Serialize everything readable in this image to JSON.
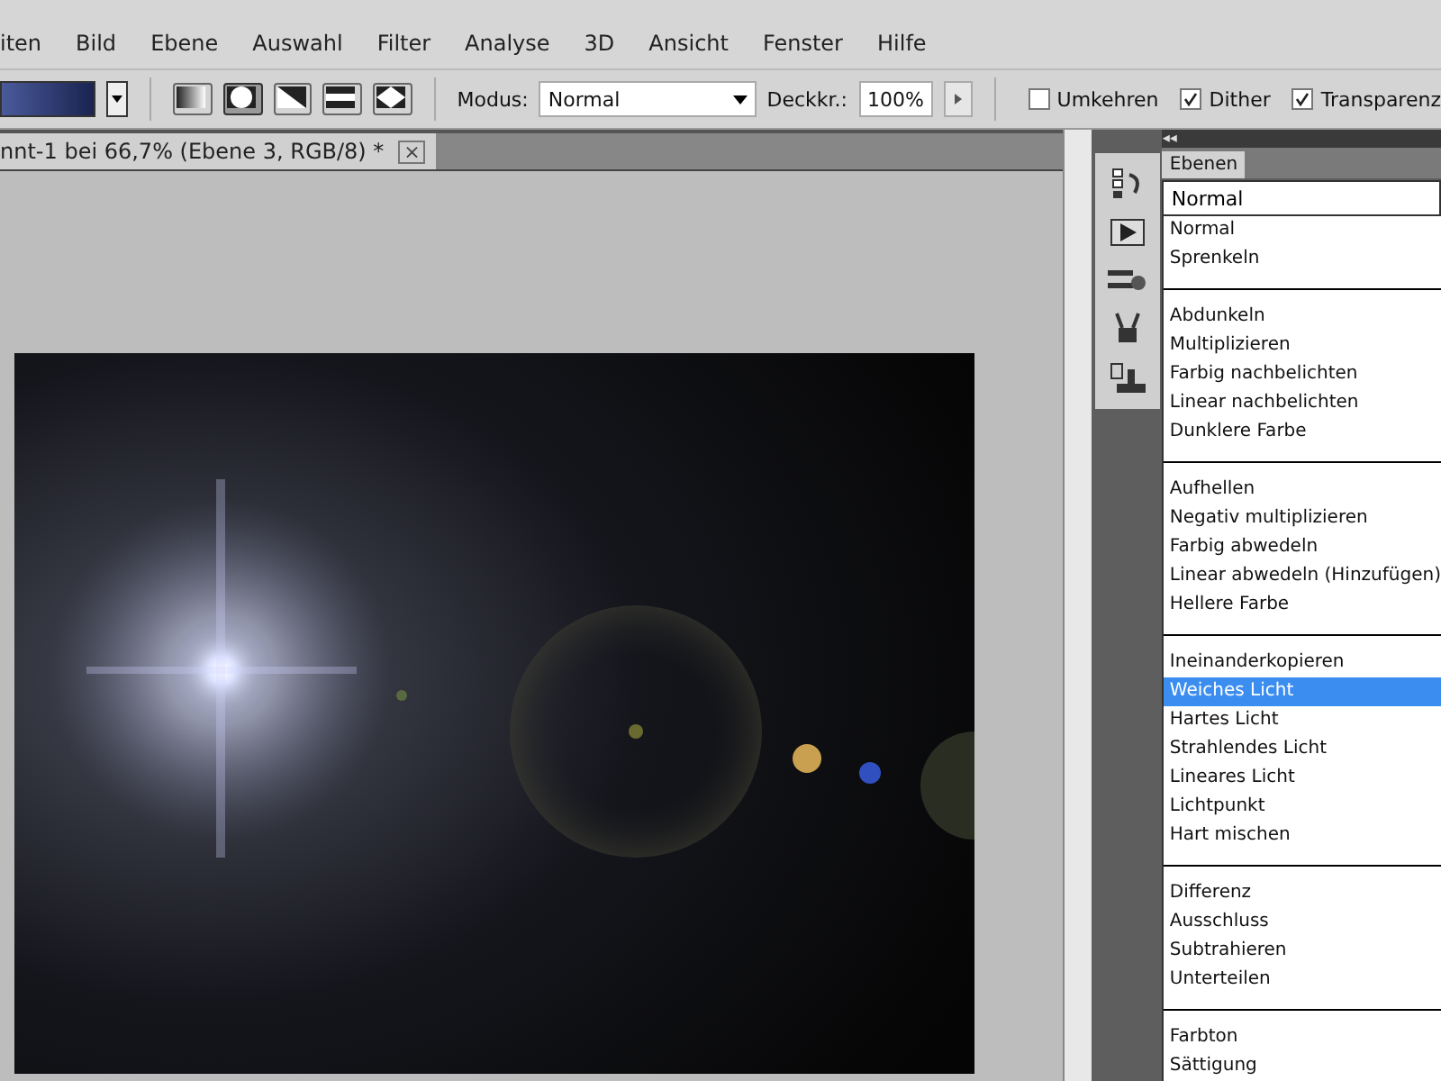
{
  "menu": [
    "iten",
    "Bild",
    "Ebene",
    "Auswahl",
    "Filter",
    "Analyse",
    "3D",
    "Ansicht",
    "Fenster",
    "Hilfe"
  ],
  "options": {
    "gradient_types": [
      {
        "selected": false
      },
      {
        "selected": true
      },
      {
        "selected": false
      },
      {
        "selected": false
      },
      {
        "selected": false
      }
    ],
    "mode_label": "Modus:",
    "mode_value": "Normal",
    "opacity_label": "Deckkr.:",
    "opacity_value": "100%",
    "checkboxes": [
      {
        "label": "Umkehren",
        "checked": false
      },
      {
        "label": "Dither",
        "checked": true
      },
      {
        "label": "Transparenz",
        "checked": true
      }
    ]
  },
  "document_tab": {
    "title": "nnt-1 bei 66,7% (Ebene 3, RGB/8) *",
    "close": "×"
  },
  "panel": {
    "collapse": "◂◂",
    "tab": "Ebenen",
    "blend_field": "Normal",
    "groups": [
      [
        {
          "label": "Normal",
          "selected": false
        },
        {
          "label": "Sprenkeln",
          "selected": false
        }
      ],
      [
        {
          "label": "Abdunkeln",
          "selected": false
        },
        {
          "label": "Multiplizieren",
          "selected": false
        },
        {
          "label": "Farbig nachbelichten",
          "selected": false
        },
        {
          "label": "Linear nachbelichten",
          "selected": false
        },
        {
          "label": "Dunklere Farbe",
          "selected": false
        }
      ],
      [
        {
          "label": "Aufhellen",
          "selected": false
        },
        {
          "label": "Negativ multiplizieren",
          "selected": false
        },
        {
          "label": "Farbig abwedeln",
          "selected": false
        },
        {
          "label": "Linear abwedeln (Hinzufügen)",
          "selected": false
        },
        {
          "label": "Hellere Farbe",
          "selected": false
        }
      ],
      [
        {
          "label": "Ineinanderkopieren",
          "selected": false
        },
        {
          "label": "Weiches Licht",
          "selected": true
        },
        {
          "label": "Hartes Licht",
          "selected": false
        },
        {
          "label": "Strahlendes Licht",
          "selected": false
        },
        {
          "label": "Lineares Licht",
          "selected": false
        },
        {
          "label": "Lichtpunkt",
          "selected": false
        },
        {
          "label": "Hart mischen",
          "selected": false
        }
      ],
      [
        {
          "label": "Differenz",
          "selected": false
        },
        {
          "label": "Ausschluss",
          "selected": false
        },
        {
          "label": "Subtrahieren",
          "selected": false
        },
        {
          "label": "Unterteilen",
          "selected": false
        }
      ],
      [
        {
          "label": "Farbton",
          "selected": false
        },
        {
          "label": "Sättigung",
          "selected": false
        }
      ]
    ]
  }
}
